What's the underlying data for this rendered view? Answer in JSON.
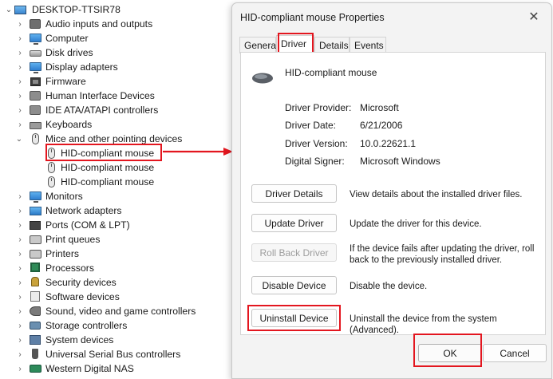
{
  "tree": {
    "root_label": "DESKTOP-TTSIR78",
    "categories": [
      {
        "label": "Audio inputs and outputs",
        "icon": "speaker-icon"
      },
      {
        "label": "Computer",
        "icon": "monitor-icon"
      },
      {
        "label": "Disk drives",
        "icon": "disk-drive-icon"
      },
      {
        "label": "Display adapters",
        "icon": "display-adapter-icon"
      },
      {
        "label": "Firmware",
        "icon": "chip-icon"
      },
      {
        "label": "Human Interface Devices",
        "icon": "hid-icon"
      },
      {
        "label": "IDE ATA/ATAPI controllers",
        "icon": "ide-controller-icon"
      },
      {
        "label": "Keyboards",
        "icon": "keyboard-icon"
      },
      {
        "label": "Mice and other pointing devices",
        "icon": "mouse-icon"
      },
      {
        "label": "HID-compliant mouse",
        "icon": "mouse-icon"
      },
      {
        "label": "HID-compliant mouse",
        "icon": "mouse-icon"
      },
      {
        "label": "HID-compliant mouse",
        "icon": "mouse-icon"
      },
      {
        "label": "Monitors",
        "icon": "monitor-icon"
      },
      {
        "label": "Network adapters",
        "icon": "network-adapter-icon"
      },
      {
        "label": "Ports (COM & LPT)",
        "icon": "port-icon"
      },
      {
        "label": "Print queues",
        "icon": "printer-icon"
      },
      {
        "label": "Printers",
        "icon": "printer-icon"
      },
      {
        "label": "Processors",
        "icon": "processor-icon"
      },
      {
        "label": "Security devices",
        "icon": "key-icon"
      },
      {
        "label": "Software devices",
        "icon": "software-device-icon"
      },
      {
        "label": "Sound, video and game controllers",
        "icon": "sound-icon"
      },
      {
        "label": "Storage controllers",
        "icon": "storage-controller-icon"
      },
      {
        "label": "System devices",
        "icon": "system-device-icon"
      },
      {
        "label": "Universal Serial Bus controllers",
        "icon": "usb-icon"
      },
      {
        "label": "Western Digital NAS",
        "icon": "nas-icon"
      }
    ]
  },
  "dialog": {
    "title": "HID-compliant mouse Properties",
    "close_glyph": "✕",
    "tabs": [
      "General",
      "Driver",
      "Details",
      "Events"
    ],
    "active_tab": "Driver",
    "device_name": "HID-compliant mouse",
    "info": [
      {
        "key": "Driver Provider:",
        "value": "Microsoft"
      },
      {
        "key": "Driver Date:",
        "value": "6/21/2006"
      },
      {
        "key": "Driver Version:",
        "value": "10.0.22621.1"
      },
      {
        "key": "Digital Signer:",
        "value": "Microsoft Windows"
      }
    ],
    "actions": [
      {
        "label": "Driver Details",
        "desc": "View details about the installed driver files.",
        "enabled": true
      },
      {
        "label": "Update Driver",
        "desc": "Update the driver for this device.",
        "enabled": true
      },
      {
        "label": "Roll Back Driver",
        "desc": "If the device fails after updating the driver, roll back to the previously installed driver.",
        "enabled": false
      },
      {
        "label": "Disable Device",
        "desc": "Disable the device.",
        "enabled": true
      },
      {
        "label": "Uninstall Device",
        "desc": "Uninstall the device from the system (Advanced).",
        "enabled": true
      }
    ],
    "ok_label": "OK",
    "cancel_label": "Cancel"
  },
  "colors": {
    "highlight_red": "#e3161f",
    "dialog_bg": "#f3f3f3"
  }
}
